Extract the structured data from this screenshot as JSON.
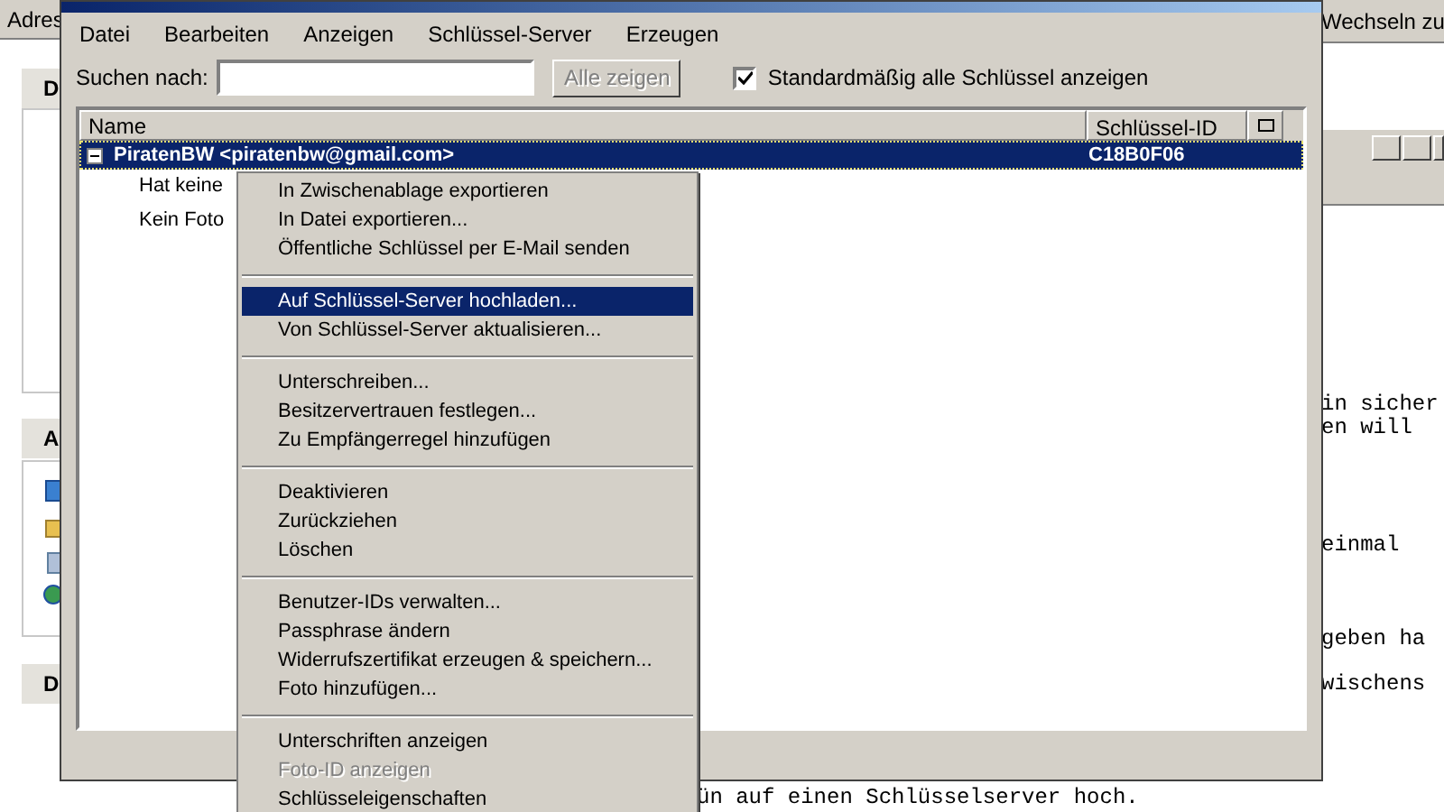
{
  "background": {
    "address_label": "Adres",
    "switch_label": "Wechseln zu",
    "sidebar_headers": [
      "D",
      "A",
      "D"
    ],
    "text_fragments": [
      "in sicher",
      "en will",
      "einmal",
      "geben ha",
      "wischens"
    ],
    "bottom_text": "ün auf einen Schlüsselserver hoch."
  },
  "window": {
    "menu": [
      "Datei",
      "Bearbeiten",
      "Anzeigen",
      "Schlüssel-Server",
      "Erzeugen"
    ],
    "search": {
      "label": "Suchen nach:"
    },
    "show_all_button": {
      "label": "Alle zeigen",
      "disabled": true
    },
    "show_all_checkbox": {
      "label": "Standardmäßig alle Schlüssel anzeigen",
      "checked": true
    },
    "table": {
      "columns": [
        "Name",
        "Schlüssel-ID"
      ],
      "rows": [
        {
          "name": "PiratenBW <piratenbw@gmail.com>",
          "key_id": "C18B0F06",
          "selected": true,
          "expanded": true,
          "children": [
            {
              "name": "Hat keine"
            },
            {
              "name": "Kein Foto"
            }
          ]
        }
      ]
    }
  },
  "context_menu": [
    {
      "items": [
        {
          "label": "In Zwischenablage exportieren",
          "selected": false,
          "disabled": false
        },
        {
          "label": "In Datei exportieren...",
          "selected": false,
          "disabled": false
        },
        {
          "label": "Öffentliche Schlüssel per E-Mail senden",
          "selected": false,
          "disabled": false
        }
      ]
    },
    {
      "items": [
        {
          "label": "Auf Schlüssel-Server hochladen...",
          "selected": true,
          "disabled": false
        },
        {
          "label": "Von Schlüssel-Server aktualisieren...",
          "selected": false,
          "disabled": false
        }
      ]
    },
    {
      "items": [
        {
          "label": "Unterschreiben...",
          "selected": false,
          "disabled": false
        },
        {
          "label": "Besitzervertrauen festlegen...",
          "selected": false,
          "disabled": false
        },
        {
          "label": "Zu Empfängerregel hinzufügen",
          "selected": false,
          "disabled": false
        }
      ]
    },
    {
      "items": [
        {
          "label": "Deaktivieren",
          "selected": false,
          "disabled": false
        },
        {
          "label": "Zurückziehen",
          "selected": false,
          "disabled": false
        },
        {
          "label": "Löschen",
          "selected": false,
          "disabled": false
        }
      ]
    },
    {
      "items": [
        {
          "label": "Benutzer-IDs verwalten...",
          "selected": false,
          "disabled": false
        },
        {
          "label": "Passphrase ändern",
          "selected": false,
          "disabled": false
        },
        {
          "label": "Widerrufszertifikat erzeugen & speichern...",
          "selected": false,
          "disabled": false
        },
        {
          "label": "Foto hinzufügen...",
          "selected": false,
          "disabled": false
        }
      ]
    },
    {
      "items": [
        {
          "label": "Unterschriften anzeigen",
          "selected": false,
          "disabled": false
        },
        {
          "label": "Foto-ID anzeigen",
          "selected": false,
          "disabled": true
        },
        {
          "label": "Schlüsseleigenschaften",
          "selected": false,
          "disabled": false
        }
      ]
    }
  ]
}
